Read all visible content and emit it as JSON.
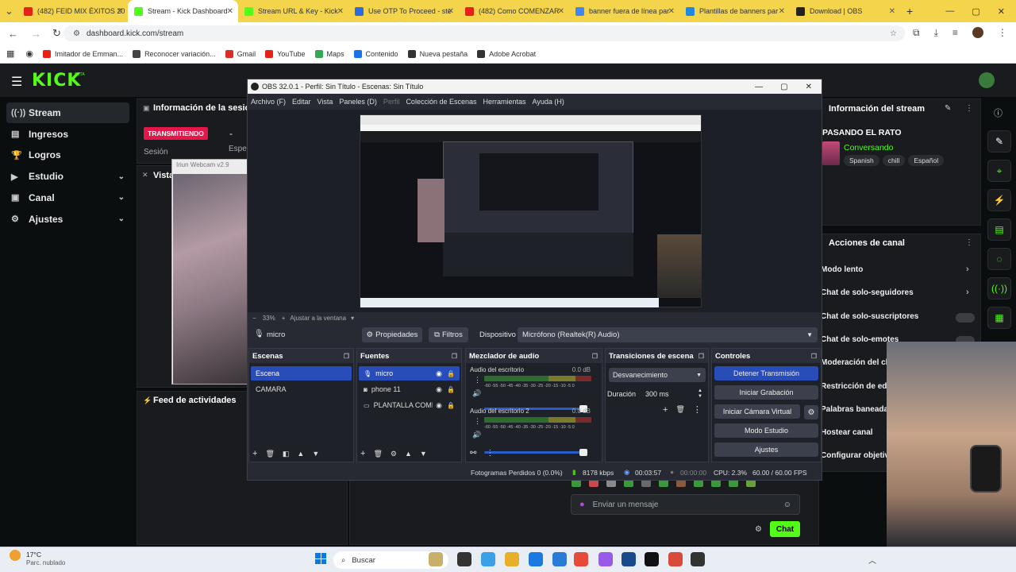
{
  "browser": {
    "tabs": [
      {
        "title": "(482) FEID MIX ÉXITOS 20",
        "color": "#e62117"
      },
      {
        "title": "Stream - Kick Dashboard",
        "color": "#53fc18"
      },
      {
        "title": "Stream URL & Key - Kick",
        "color": "#53fc18"
      },
      {
        "title": "Use OTP To Proceed - ste",
        "color": "#2d6cdf"
      },
      {
        "title": "(482) Como COMENZAR",
        "color": "#e62117"
      },
      {
        "title": "banner fuera de línea par",
        "color": "#4285f4"
      },
      {
        "title": "Plantillas de banners par",
        "color": "#1e88e5"
      },
      {
        "title": "Download | OBS",
        "color": "#222222"
      }
    ],
    "url": "dashboard.kick.com/stream",
    "bookmarks": [
      {
        "label": "Imitador de Emman...",
        "color": "#e62117"
      },
      {
        "label": "Reconocer variación...",
        "color": "#444444"
      },
      {
        "label": "Gmail",
        "color": "#d93025"
      },
      {
        "label": "YouTube",
        "color": "#e62117"
      },
      {
        "label": "Maps",
        "color": "#34a853"
      },
      {
        "label": "Contenido",
        "color": "#1a73e8"
      },
      {
        "label": "Nueva pestaña",
        "color": "#333333"
      },
      {
        "label": "Adobe Acrobat",
        "color": "#333333"
      }
    ]
  },
  "kick": {
    "logo": "KICK",
    "beta": "BETA",
    "nav": [
      {
        "label": "Stream",
        "icon": "broadcast-icon"
      },
      {
        "label": "Ingresos",
        "icon": "money-icon"
      },
      {
        "label": "Logros",
        "icon": "trophy-icon"
      },
      {
        "label": "Estudio",
        "icon": "film-icon"
      },
      {
        "label": "Canal",
        "icon": "tv-icon"
      },
      {
        "label": "Ajustes",
        "icon": "gear-icon"
      }
    ],
    "session_title": "Información de la sesión",
    "live_badge": "TRANSMITIENDO",
    "session_label": "Sesión",
    "session_dash": "-",
    "spectators_label": "Espe",
    "vista_label": "Vista",
    "webcam_window": "Iriun Webcam v2.9",
    "activity_feed": "Feed de actividades",
    "stream_info_title": "Información del stream",
    "stream_title": "PASANDO EL RATO",
    "category": "Conversando",
    "tags": [
      "Spanish",
      "chill",
      "Español"
    ],
    "channel_actions_title": "Acciones de canal",
    "channel_actions": [
      {
        "label": "Modo lento"
      },
      {
        "label": "Chat de solo-seguidores"
      },
      {
        "label": "Chat de solo-suscriptores"
      },
      {
        "label": "Chat de solo-emotes"
      },
      {
        "label": "Moderación del cha"
      },
      {
        "label": "Restricción de edad"
      },
      {
        "label": "Palabras baneadas"
      },
      {
        "label": "Hostear canal"
      },
      {
        "label": "Configurar objetiv"
      }
    ],
    "chat_placeholder": "Enviar un mensaje",
    "chat_button": "Chat"
  },
  "obs": {
    "title": "OBS 32.0.1 - Perfil: Sin Título - Escenas: Sin Título",
    "menu": [
      "Archivo (F)",
      "Editar",
      "Vista",
      "Paneles (D)",
      "Perfil",
      "Colección de Escenas",
      "Herramientas",
      "Ayuda (H)"
    ],
    "zoom": "33%",
    "fit": "Ajustar a la ventana",
    "source_name": "micro",
    "properties_btn": "Propiedades",
    "filters_btn": "Filtros",
    "device_label": "Dispositivo",
    "device_value": "Micrófono (Realtek(R) Audio)",
    "scenes_title": "Escenas",
    "scenes": [
      "Escena",
      "CAMARA"
    ],
    "sources_title": "Fuentes",
    "sources": [
      {
        "label": "micro",
        "icon": "mic-icon"
      },
      {
        "label": "phone 11",
        "icon": "camera-icon"
      },
      {
        "label": "PLANTALLA COMP",
        "icon": "monitor-icon"
      }
    ],
    "mixer_title": "Mezclador de audio",
    "mixer_channels": [
      {
        "name": "Audio del escritorio",
        "db": "0.0 dB"
      },
      {
        "name": "Audio del escritorio 2",
        "db": "0.0 dB"
      }
    ],
    "meter_scale": "-60 -55 -50 -45 -40 -35 -30 -25 -20 -15 -10 -5 0",
    "transitions_title": "Transiciones de escena",
    "transition": "Desvanecimiento",
    "duration_label": "Duración",
    "duration_value": "300 ms",
    "controls_title": "Controles",
    "controls": [
      "Detener Transmisión",
      "Iniciar Grabación",
      "Iniciar Cámara Virtual",
      "Modo Estudio",
      "Ajustes"
    ],
    "status": {
      "dropped": "Fotogramas Perdidos 0 (0.0%)",
      "bitrate": "8178 kbps",
      "live_time": "00:03:57",
      "rec_time": "00:00:00",
      "cpu": "CPU: 2.3%",
      "fps": "60.00 / 60.00 FPS"
    }
  },
  "taskbar": {
    "weather_temp": "17°C",
    "weather_desc": "Parc. nublado",
    "search": "Buscar"
  }
}
